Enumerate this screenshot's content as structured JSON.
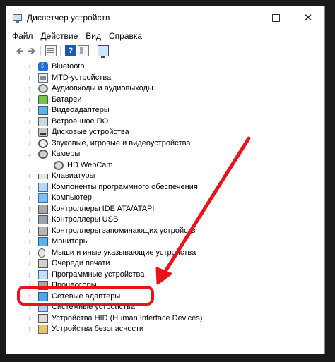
{
  "window": {
    "title": "Диспетчер устройств",
    "close_symbol": "✕"
  },
  "menu": [
    "Файл",
    "Действие",
    "Вид",
    "Справка"
  ],
  "toolbar": {
    "back_symbol": "🡸",
    "forward_symbol": "🡺",
    "help_symbol": "?"
  },
  "tree": {
    "collapsed_symbol": "›",
    "expanded_symbol": "⌄",
    "items": [
      {
        "label": "Bluetooth",
        "icon": "bluetooth-icon",
        "expanded": false
      },
      {
        "label": "MTD-устройства",
        "icon": "mtd-device-icon",
        "expanded": false
      },
      {
        "label": "Аудиовходы и аудиовыходы",
        "icon": "audio-io-icon",
        "expanded": false
      },
      {
        "label": "Батареи",
        "icon": "battery-icon",
        "expanded": false
      },
      {
        "label": "Видеоадаптеры",
        "icon": "video-adapter-icon",
        "expanded": false
      },
      {
        "label": "Встроенное ПО",
        "icon": "firmware-icon",
        "expanded": false
      },
      {
        "label": "Дисковые устройства",
        "icon": "disk-drive-icon",
        "expanded": false
      },
      {
        "label": "Звуковые, игровые и видеоустройства",
        "icon": "sound-device-icon",
        "expanded": false
      },
      {
        "label": "Камеры",
        "icon": "camera-icon",
        "expanded": true
      },
      {
        "label": "HD WebCam",
        "icon": "webcam-icon",
        "child": true
      },
      {
        "label": "Клавиатуры",
        "icon": "keyboard-icon",
        "expanded": false
      },
      {
        "label": "Компоненты программного обеспечения",
        "icon": "software-component-icon",
        "expanded": false
      },
      {
        "label": "Компьютер",
        "icon": "computer-icon",
        "expanded": false
      },
      {
        "label": "Контроллеры IDE ATA/ATAPI",
        "icon": "ide-controller-icon",
        "expanded": false
      },
      {
        "label": "Контроллеры USB",
        "icon": "usb-controller-icon",
        "expanded": false
      },
      {
        "label": "Контроллеры запоминающих устройств",
        "icon": "storage-controller-icon",
        "expanded": false
      },
      {
        "label": "Мониторы",
        "icon": "monitor-icon",
        "expanded": false
      },
      {
        "label": "Мыши и иные указывающие устройства",
        "icon": "mouse-icon",
        "expanded": false
      },
      {
        "label": "Очереди печати",
        "icon": "print-queue-icon",
        "expanded": false
      },
      {
        "label": "Программные устройства",
        "icon": "software-device-icon",
        "expanded": false
      },
      {
        "label": "Процессоры",
        "icon": "processor-icon",
        "expanded": false
      },
      {
        "label": "Сетевые адаптеры",
        "icon": "network-adapter-icon",
        "expanded": false,
        "highlighted": true
      },
      {
        "label": "Системные устройства",
        "icon": "system-device-icon",
        "expanded": false
      },
      {
        "label": "Устройства HID (Human Interface Devices)",
        "icon": "hid-device-icon",
        "expanded": false
      },
      {
        "label": "Устройства безопасности",
        "icon": "security-device-icon",
        "expanded": false
      }
    ]
  },
  "annotation": {
    "color": "#e8141c",
    "shape": "arrow-and-rounded-box",
    "target": "Сетевые адаптеры"
  }
}
